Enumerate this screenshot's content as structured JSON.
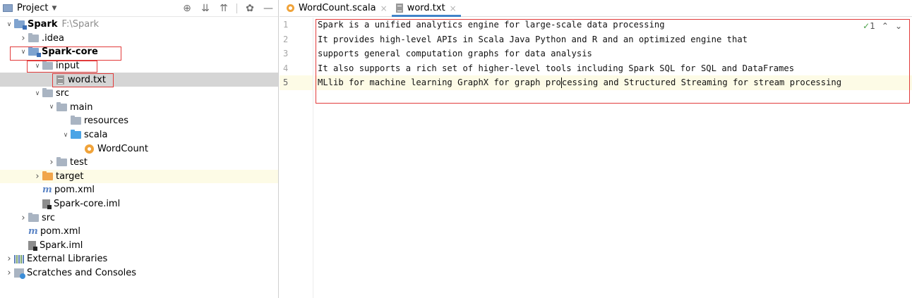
{
  "project_panel": {
    "title": "Project",
    "toolbar_icons": [
      "locate-icon",
      "expand-all-icon",
      "collapse-all-icon",
      "settings-icon",
      "hide-icon"
    ],
    "tree": [
      {
        "label": "Spark",
        "extra": "F:\\Spark",
        "icon": "module-folder-icon",
        "depth": 0,
        "expanded": true,
        "bold": true
      },
      {
        "label": ".idea",
        "icon": "folder-icon",
        "depth": 1,
        "expanded": false
      },
      {
        "label": "Spark-core",
        "icon": "module-folder-icon",
        "depth": 1,
        "expanded": true,
        "bold": true
      },
      {
        "label": "input",
        "icon": "folder-icon",
        "depth": 2,
        "expanded": true
      },
      {
        "label": "word.txt",
        "icon": "text-file-icon",
        "depth": 3,
        "selected": true
      },
      {
        "label": "src",
        "icon": "folder-icon",
        "depth": 2,
        "expanded": true
      },
      {
        "label": "main",
        "icon": "folder-icon",
        "depth": 3,
        "expanded": true
      },
      {
        "label": "resources",
        "icon": "resources-folder-icon",
        "depth": 4
      },
      {
        "label": "scala",
        "icon": "source-folder-icon",
        "depth": 4,
        "expanded": true
      },
      {
        "label": "WordCount",
        "icon": "scala-object-icon",
        "depth": 5
      },
      {
        "label": "test",
        "icon": "folder-icon",
        "depth": 3,
        "expanded": false
      },
      {
        "label": "target",
        "icon": "excluded-folder-icon",
        "depth": 2,
        "expanded": false,
        "highlight": true
      },
      {
        "label": "pom.xml",
        "icon": "maven-icon",
        "depth": 2
      },
      {
        "label": "Spark-core.iml",
        "icon": "iml-file-icon",
        "depth": 2
      },
      {
        "label": "src",
        "icon": "folder-icon",
        "depth": 1,
        "expanded": false
      },
      {
        "label": "pom.xml",
        "icon": "maven-icon",
        "depth": 1
      },
      {
        "label": "Spark.iml",
        "icon": "iml-file-icon",
        "depth": 1
      },
      {
        "label": "External Libraries",
        "icon": "libraries-icon",
        "depth": 0,
        "expanded": false
      },
      {
        "label": "Scratches and Consoles",
        "icon": "scratches-icon",
        "depth": 0,
        "expanded": false
      }
    ]
  },
  "editor": {
    "tabs": [
      {
        "label": "WordCount.scala",
        "icon": "scala-object-icon",
        "active": false
      },
      {
        "label": "word.txt",
        "icon": "text-file-icon",
        "active": true
      }
    ],
    "inspection": {
      "count": "1"
    },
    "current_line": 5,
    "lines": [
      "Spark is a unified analytics engine for large-scale data processing",
      "It provides high-level APIs in Scala Java Python and R and an optimized engine that",
      "supports general computation graphs for data analysis",
      "It also supports a rich set of higher-level tools including Spark SQL for SQL and DataFrames",
      "MLlib for machine learning GraphX for graph processing and Structured Streaming for stream processing"
    ],
    "line_numbers": [
      "1",
      "2",
      "3",
      "4",
      "5"
    ]
  },
  "colors": {
    "annotation_red": "#e23b3b",
    "selection": "#d5d5d5",
    "current_line": "#fdfbe6",
    "tab_underline": "#4083c9"
  }
}
